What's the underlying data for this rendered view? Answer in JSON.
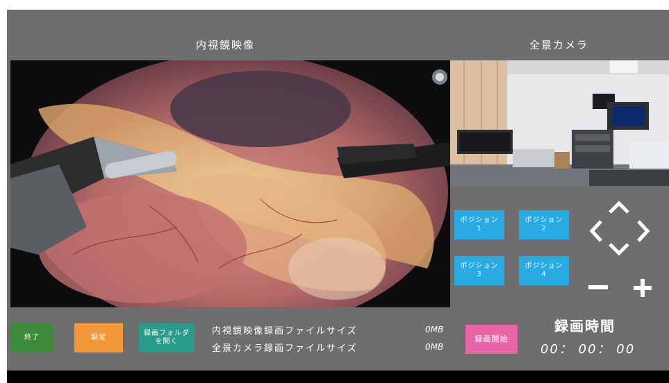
{
  "panels": {
    "endoscope_title": "内視鏡映像",
    "panorama_title": "全景カメラ"
  },
  "position_buttons": [
    {
      "label": "ポジション\n1"
    },
    {
      "label": "ポジション\n2"
    },
    {
      "label": "ポジション\n3"
    },
    {
      "label": "ポジション\n4"
    }
  ],
  "controls": {
    "pan_up": "chevron-up-icon",
    "pan_left": "chevron-left-icon",
    "pan_right": "chevron-right-icon",
    "pan_down": "chevron-down-icon",
    "zoom_out": "minus-icon",
    "zoom_in": "plus-icon"
  },
  "bottom": {
    "exit_label": "終了",
    "settings_label": "設定",
    "open_folder_label": "録画フォルダ\nを開く",
    "endo_file_size_label": "内視鏡映像録画ファイルサイズ",
    "endo_file_size_value": "0MB",
    "pano_file_size_label": "全景カメラ録画ファイルサイズ",
    "pano_file_size_value": "0MB",
    "record_start_label": "録画開始",
    "record_time_title": "録画時間",
    "record_time_value": "00： 00： 00"
  },
  "colors": {
    "background": "#6e6e6e",
    "position_button": "#2aaae2",
    "exit_button": "#3d8a3b",
    "settings_button": "#f2983a",
    "folder_button": "#2a9b8a",
    "record_button": "#e866a8"
  }
}
